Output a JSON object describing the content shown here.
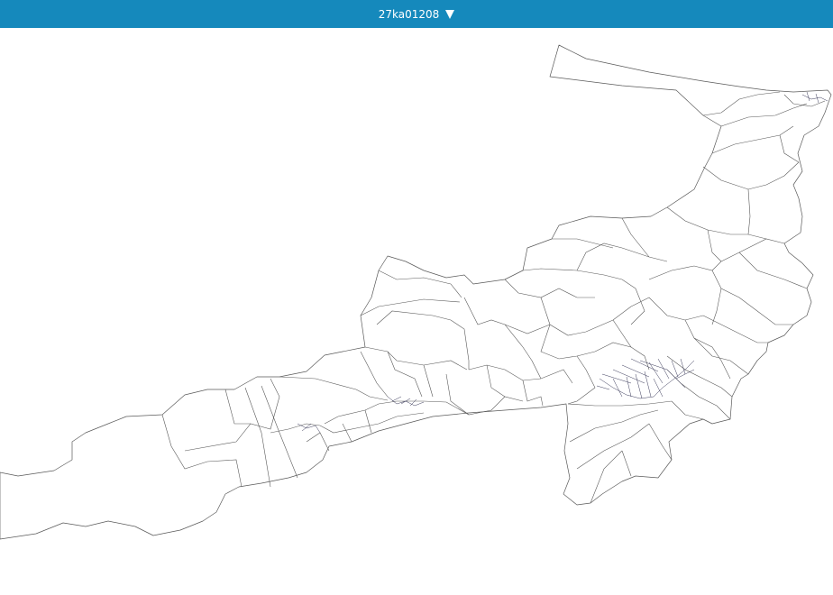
{
  "header": {
    "selected_code": "27ka01208",
    "dropdown_icon": "triangle-down-icon",
    "background_color": "#1589bc",
    "text_color": "#ffffff"
  },
  "map": {
    "boundary_color": "#5a5a5a",
    "fill_color": "#ffffff"
  }
}
